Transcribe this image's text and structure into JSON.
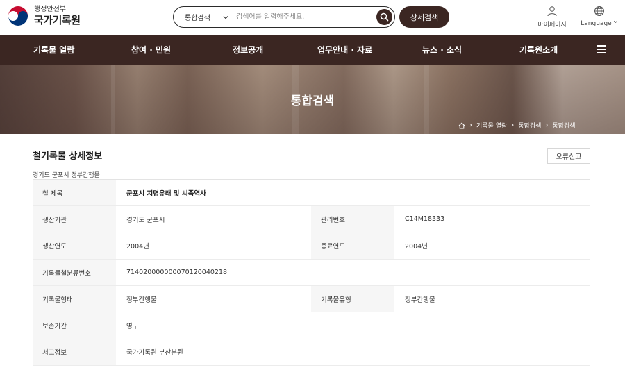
{
  "header": {
    "ministry": "행정안전부",
    "org_name": "국가기록원",
    "search": {
      "scope": "통합검색",
      "placeholder": "검색어를 입력해주세요."
    },
    "detail_search_label": "상세검색",
    "mypage_label": "마이페이지",
    "language_label": "Language"
  },
  "nav": {
    "items": [
      "기록물 열람",
      "참여 · 민원",
      "정보공개",
      "업무안내 · 자료",
      "뉴스 · 소식",
      "기록원소개"
    ]
  },
  "hero": {
    "title": "통합검색",
    "breadcrumb": [
      "기록물 열람",
      "통합검색",
      "통합검색"
    ]
  },
  "content": {
    "section_title": "철기록물 상세정보",
    "report_label": "오류신고",
    "sub_title": "경기도 군포시 정부간행물",
    "rows": [
      {
        "label": "철 제목",
        "value": "군포시 지명유래 및 씨족역사"
      },
      {
        "label": "생산기관",
        "value": "경기도 군포시",
        "label2": "관리번호",
        "value2": "C14M18333"
      },
      {
        "label": "생산연도",
        "value": "2004년",
        "label2": "종료연도",
        "value2": "2004년"
      },
      {
        "label": "기록물철분류번호",
        "value": "714020000000070120040218"
      },
      {
        "label": "기록물형태",
        "value": "정부간행물",
        "label2": "기록물유형",
        "value2": "정부간행물"
      },
      {
        "label": "보존기간",
        "value": "영구"
      },
      {
        "label": "서고정보",
        "value": "국가기록원 부산분원"
      }
    ]
  },
  "colors": {
    "brand_dark": "#3b2622",
    "row_header_bg": "#f6f6f6",
    "border": "#ececec"
  }
}
